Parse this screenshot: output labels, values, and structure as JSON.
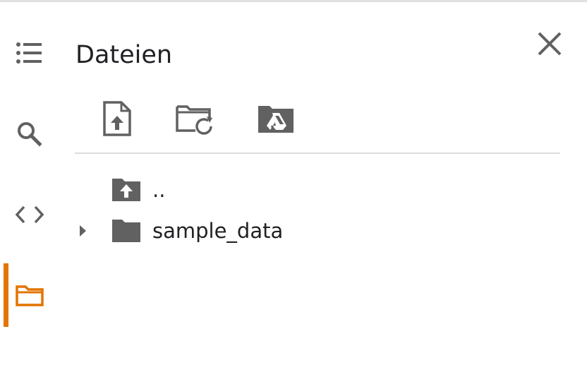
{
  "panel": {
    "title": "Dateien"
  },
  "rail": {
    "items": [
      {
        "name": "table-of-contents",
        "icon": "list-icon",
        "active": false
      },
      {
        "name": "search",
        "icon": "search-icon",
        "active": false
      },
      {
        "name": "code-snippets",
        "icon": "code-icon",
        "active": false
      },
      {
        "name": "files",
        "icon": "folder-icon",
        "active": true
      }
    ],
    "active_color": "#e37400"
  },
  "toolbar": {
    "buttons": [
      {
        "icon": "upload-file-icon"
      },
      {
        "icon": "refresh-folder-icon"
      },
      {
        "icon": "mount-drive-icon"
      }
    ]
  },
  "tree": {
    "items": [
      {
        "label": "..",
        "icon": "parent-folder-icon",
        "expandable": false
      },
      {
        "label": "sample_data",
        "icon": "folder-icon",
        "expandable": true
      }
    ]
  },
  "colors": {
    "icon_gray": "#616161",
    "text": "#202124",
    "divider": "#dadce0",
    "accent": "#e37400"
  }
}
